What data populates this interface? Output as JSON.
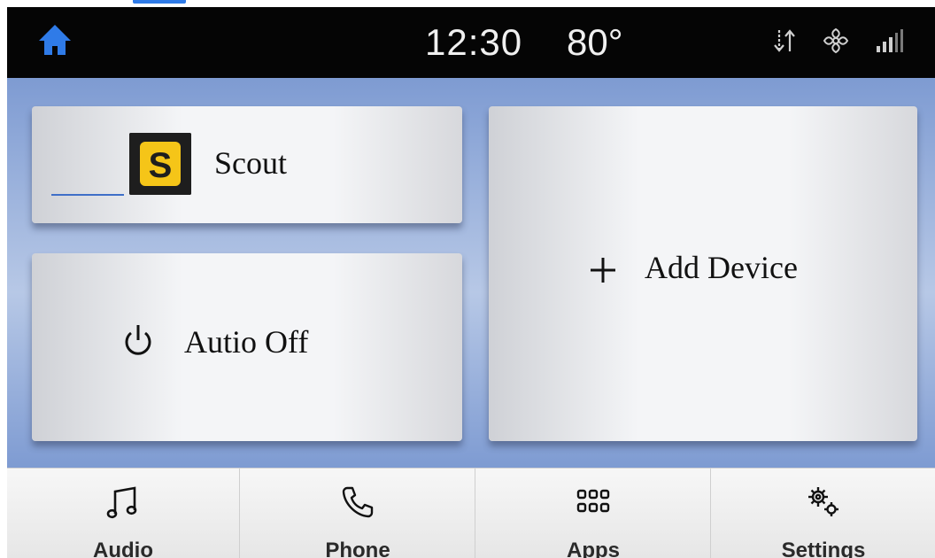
{
  "status_bar": {
    "time": "12:30",
    "temperature": "80°",
    "icons": [
      "home-icon",
      "sync-arrows-icon",
      "fan-icon",
      "signal-strength-icon"
    ]
  },
  "devices": {
    "scout_label": "Scout",
    "scout_logo_letter": "S",
    "audio_off_label": "Autio Off",
    "add_device_label": "Add Device"
  },
  "nav": {
    "items": [
      {
        "label": "Audio",
        "icon": "music-note-icon"
      },
      {
        "label": "Phone",
        "icon": "phone-icon"
      },
      {
        "label": "Apps",
        "icon": "apps-grid-icon"
      },
      {
        "label": "Settings",
        "icon": "gears-icon"
      }
    ]
  },
  "colors": {
    "accent": "#2f7be8",
    "background_blue": "#7a98cf",
    "scout_yellow": "#f5c518"
  }
}
